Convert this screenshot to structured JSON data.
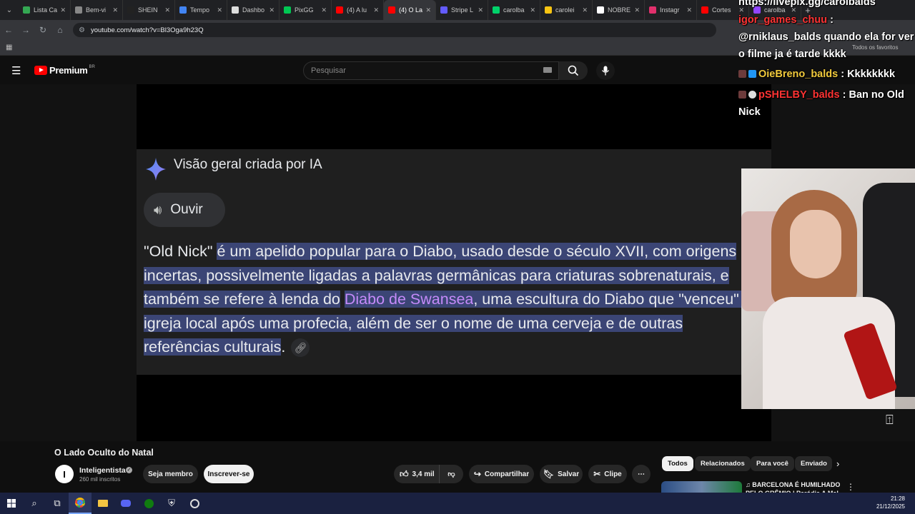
{
  "browser": {
    "tabs": [
      {
        "label": "Lista Ca",
        "color": "#34a853",
        "active": false
      },
      {
        "label": "Bem-vi",
        "color": "#888888",
        "active": false
      },
      {
        "label": "SHEIN",
        "color": "#222222",
        "active": false
      },
      {
        "label": "Tempo",
        "color": "#4285f4",
        "active": false
      },
      {
        "label": "Dashbo",
        "color": "#dddddd",
        "active": false
      },
      {
        "label": "PixGG",
        "color": "#00c853",
        "active": false
      },
      {
        "label": "(4) A lu",
        "color": "#ff0000",
        "active": false
      },
      {
        "label": "(4) O La",
        "color": "#ff0000",
        "active": true
      },
      {
        "label": "Stripe L",
        "color": "#635bff",
        "active": false
      },
      {
        "label": "carolba",
        "color": "#00d26a",
        "active": false
      },
      {
        "label": "carolei",
        "color": "#f9c513",
        "active": false
      },
      {
        "label": "NOBRE",
        "color": "#ffffff",
        "active": false
      },
      {
        "label": "Instagr",
        "color": "#e1306c",
        "active": false
      },
      {
        "label": "Cortes",
        "color": "#ff0000",
        "active": false
      },
      {
        "label": "carolba",
        "color": "#9146ff",
        "active": false
      }
    ],
    "url": "youtube.com/watch?v=Bl3Oga9h23Q",
    "all_bookmarks_label": "Todos os favoritos"
  },
  "youtube": {
    "logo_word": "Premium",
    "logo_region": "BR",
    "search_placeholder": "Pesquisar"
  },
  "overlay": {
    "title": "Visão geral criada por IA",
    "listen_label": "Ouvir",
    "text_plain_start": "\"Old Nick\"",
    "text_highlight_1": "é um apelido popular para o Diabo, usado desde o século XVII, com origens incertas, possivelmente ligadas a palavras germânicas para criaturas sobrenaturais, e também se refere à lenda do",
    "text_link": "Diabo de Swansea",
    "text_highlight_2": ", uma escultura do Diabo que \"venceu\" a igreja local após uma profecia, além de ser o nome de uma cerveja e de outras referências culturais",
    "text_end": "."
  },
  "chat": [
    {
      "user": "",
      "text": "https://livepix.gg/carolbalds"
    },
    {
      "user": "igor_games_chuu",
      "text": " : @rniklaus_balds quando ela for ver o filme ja é tarde kkkk",
      "name_color": "red"
    },
    {
      "user": "OieBreno_balds",
      "text": " : Kkkkkkkk",
      "name_color": "yellow"
    },
    {
      "user": "pSHELBY_balds",
      "text": " : Ban no Old Nick",
      "name_color": "red"
    }
  ],
  "video": {
    "title": "O Lado Oculto do Natal",
    "channel": "Inteligentista",
    "channel_initial": "I",
    "subscribers": "260 mil inscritos",
    "member_label": "Seja membro",
    "subscribe_label": "Inscrever-se",
    "likes": "3,4 mil",
    "share_label": "Compartilhar",
    "save_label": "Salvar",
    "clip_label": "Clipe"
  },
  "chips": [
    "Todos",
    "Relacionados",
    "Para você",
    "Enviado"
  ],
  "recommended": {
    "title": "♫ BARCELONA É HUMILHADO PELO GRÊMIO | Paródia A Mal"
  },
  "taskbar": {
    "time": "21:28",
    "date": "21/12/2025"
  }
}
